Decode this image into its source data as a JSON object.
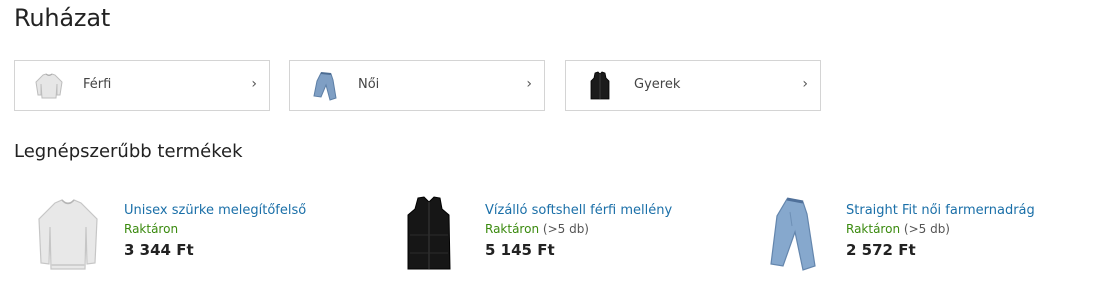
{
  "page": {
    "title": "Ruházat"
  },
  "categories": [
    {
      "label": "Férfi",
      "icon": "sweater-icon"
    },
    {
      "label": "Női",
      "icon": "jeans-icon"
    },
    {
      "label": "Gyerek",
      "icon": "vest-icon"
    }
  ],
  "chevron": "›",
  "popular": {
    "title": "Legnépszerűbb termékek",
    "items": [
      {
        "name": "Unisex szürke melegítőfelső",
        "stock": "Raktáron",
        "qty": "",
        "price": "3 344 Ft",
        "icon": "sweater-icon"
      },
      {
        "name": "Vízálló softshell férfi mellény",
        "stock": "Raktáron",
        "qty": "(>5 db)",
        "price": "5 145 Ft",
        "icon": "vest-icon"
      },
      {
        "name": "Straight Fit női farmernadrág",
        "stock": "Raktáron",
        "qty": "(>5 db)",
        "price": "2 572 Ft",
        "icon": "jeans-icon"
      }
    ]
  },
  "colors": {
    "link": "#1a6fa8",
    "in_stock": "#3a8a0e",
    "border": "#d4d4d4"
  }
}
